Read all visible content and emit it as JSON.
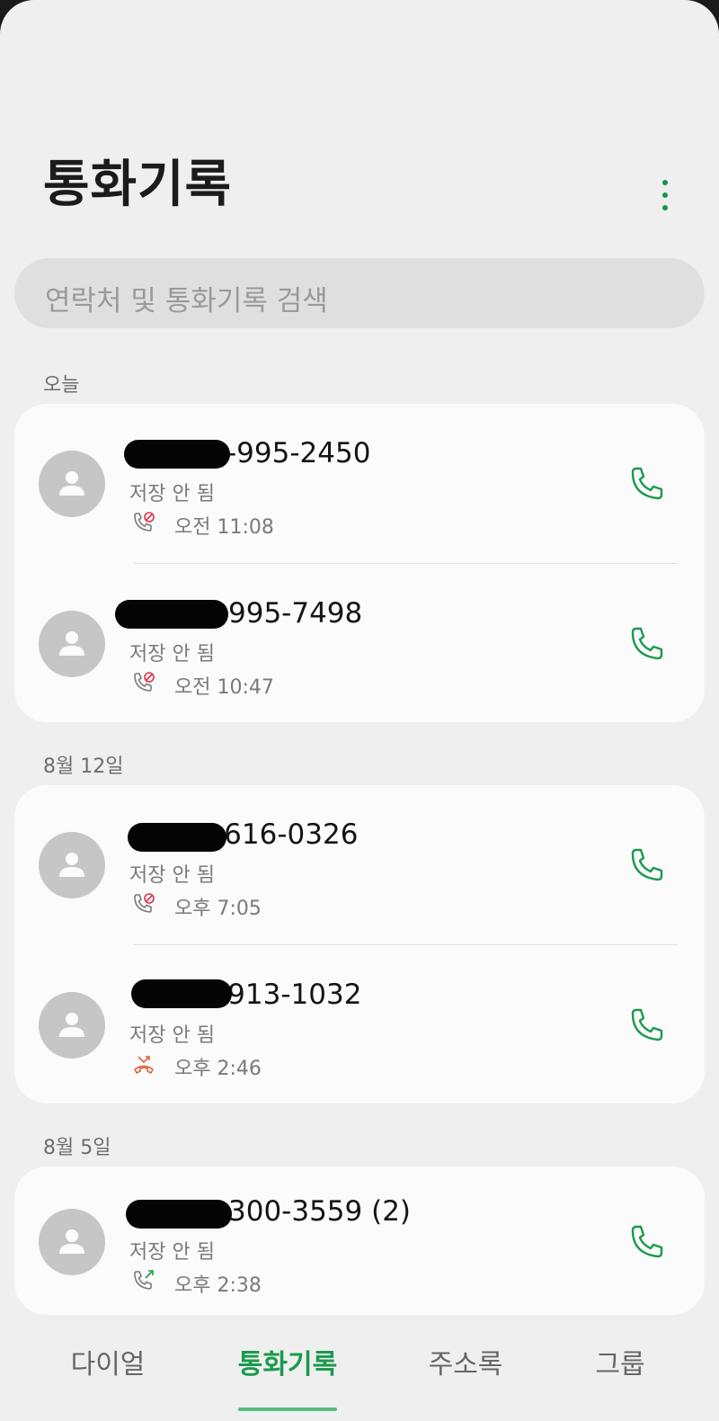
{
  "header": {
    "title": "통화기록"
  },
  "search": {
    "placeholder": "연락처 및 통화기록 검색"
  },
  "sections": [
    {
      "label": "오늘",
      "entries": [
        {
          "number": "-995-2450",
          "status": "저장 안 됨",
          "time": "오전 11:08",
          "call_type_icon": "blocked-call-icon"
        },
        {
          "number": "995-7498",
          "status": "저장 안 됨",
          "time": "오전 10:47",
          "call_type_icon": "blocked-call-icon"
        }
      ]
    },
    {
      "label": "8월 12일",
      "entries": [
        {
          "number": "-616-0326",
          "status": "저장 안 됨",
          "time": "오후 7:05",
          "call_type_icon": "blocked-call-icon"
        },
        {
          "number": "-913-1032",
          "status": "저장 안 됨",
          "time": "오후 2:46",
          "call_type_icon": "missed-call-icon"
        }
      ]
    },
    {
      "label": "8월 5일",
      "entries": [
        {
          "number": "300-3559 (2)",
          "status": "저장 안 됨",
          "time": "오후 2:38",
          "call_type_icon": "outgoing-call-icon"
        }
      ]
    }
  ],
  "bottom_nav": {
    "items": [
      {
        "label": "다이얼"
      },
      {
        "label": "통화기록"
      },
      {
        "label": "주소록"
      },
      {
        "label": "그룹"
      }
    ],
    "active_index": 1
  },
  "colors": {
    "accent": "#1b9a4d",
    "missed": "#e0643a",
    "blocked": "#e0304a"
  }
}
